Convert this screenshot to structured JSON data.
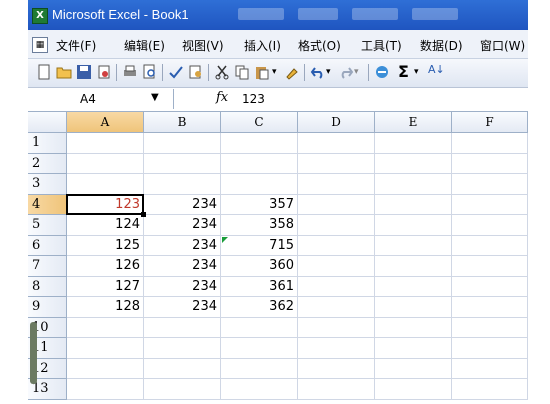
{
  "window": {
    "title": "Microsoft Excel - Book1"
  },
  "menu": [
    "文件(F)",
    "编辑(E)",
    "视图(V)",
    "插入(I)",
    "格式(O)",
    "工具(T)",
    "数据(D)",
    "窗口(W)"
  ],
  "formula_bar": {
    "name_box": "A4",
    "fx_label": "fx",
    "content": "123"
  },
  "columns": [
    "A",
    "B",
    "C",
    "D",
    "E",
    "F"
  ],
  "rows": [
    "1",
    "2",
    "3",
    "4",
    "5",
    "6",
    "7",
    "8",
    "9",
    "10",
    "11",
    "12",
    "13"
  ],
  "cells": [
    {
      "ref": "A4",
      "text": "123"
    },
    {
      "ref": "B4",
      "text": "234"
    },
    {
      "ref": "C4",
      "text": "357"
    },
    {
      "ref": "A5",
      "text": "124"
    },
    {
      "ref": "B5",
      "text": "234"
    },
    {
      "ref": "C5",
      "text": "358"
    },
    {
      "ref": "A6",
      "text": "125"
    },
    {
      "ref": "B6",
      "text": "234"
    },
    {
      "ref": "C6",
      "text": "715"
    },
    {
      "ref": "A7",
      "text": "126"
    },
    {
      "ref": "B7",
      "text": "234"
    },
    {
      "ref": "C7",
      "text": "360"
    },
    {
      "ref": "A8",
      "text": "127"
    },
    {
      "ref": "B8",
      "text": "234"
    },
    {
      "ref": "C8",
      "text": "361"
    },
    {
      "ref": "A9",
      "text": "128"
    },
    {
      "ref": "B9",
      "text": "234"
    },
    {
      "ref": "C9",
      "text": "362"
    }
  ],
  "selection": {
    "active_cell": "A4",
    "selected_column": "A",
    "selected_row": "4"
  },
  "colors": {
    "title_blue": "#1f55c0",
    "active_cell_text": "#c0392b",
    "error_indicator": "#1a9d3a"
  },
  "toolbar_icons": [
    "new-icon",
    "open-icon",
    "save-icon",
    "permission-icon",
    "print-icon",
    "print-preview-icon",
    "spelling-icon",
    "research-icon",
    "cut-icon",
    "copy-icon",
    "paste-icon",
    "format-painter-icon",
    "undo-icon",
    "redo-icon",
    "hyperlink-icon",
    "autosum-icon",
    "sort-ascending-icon"
  ]
}
